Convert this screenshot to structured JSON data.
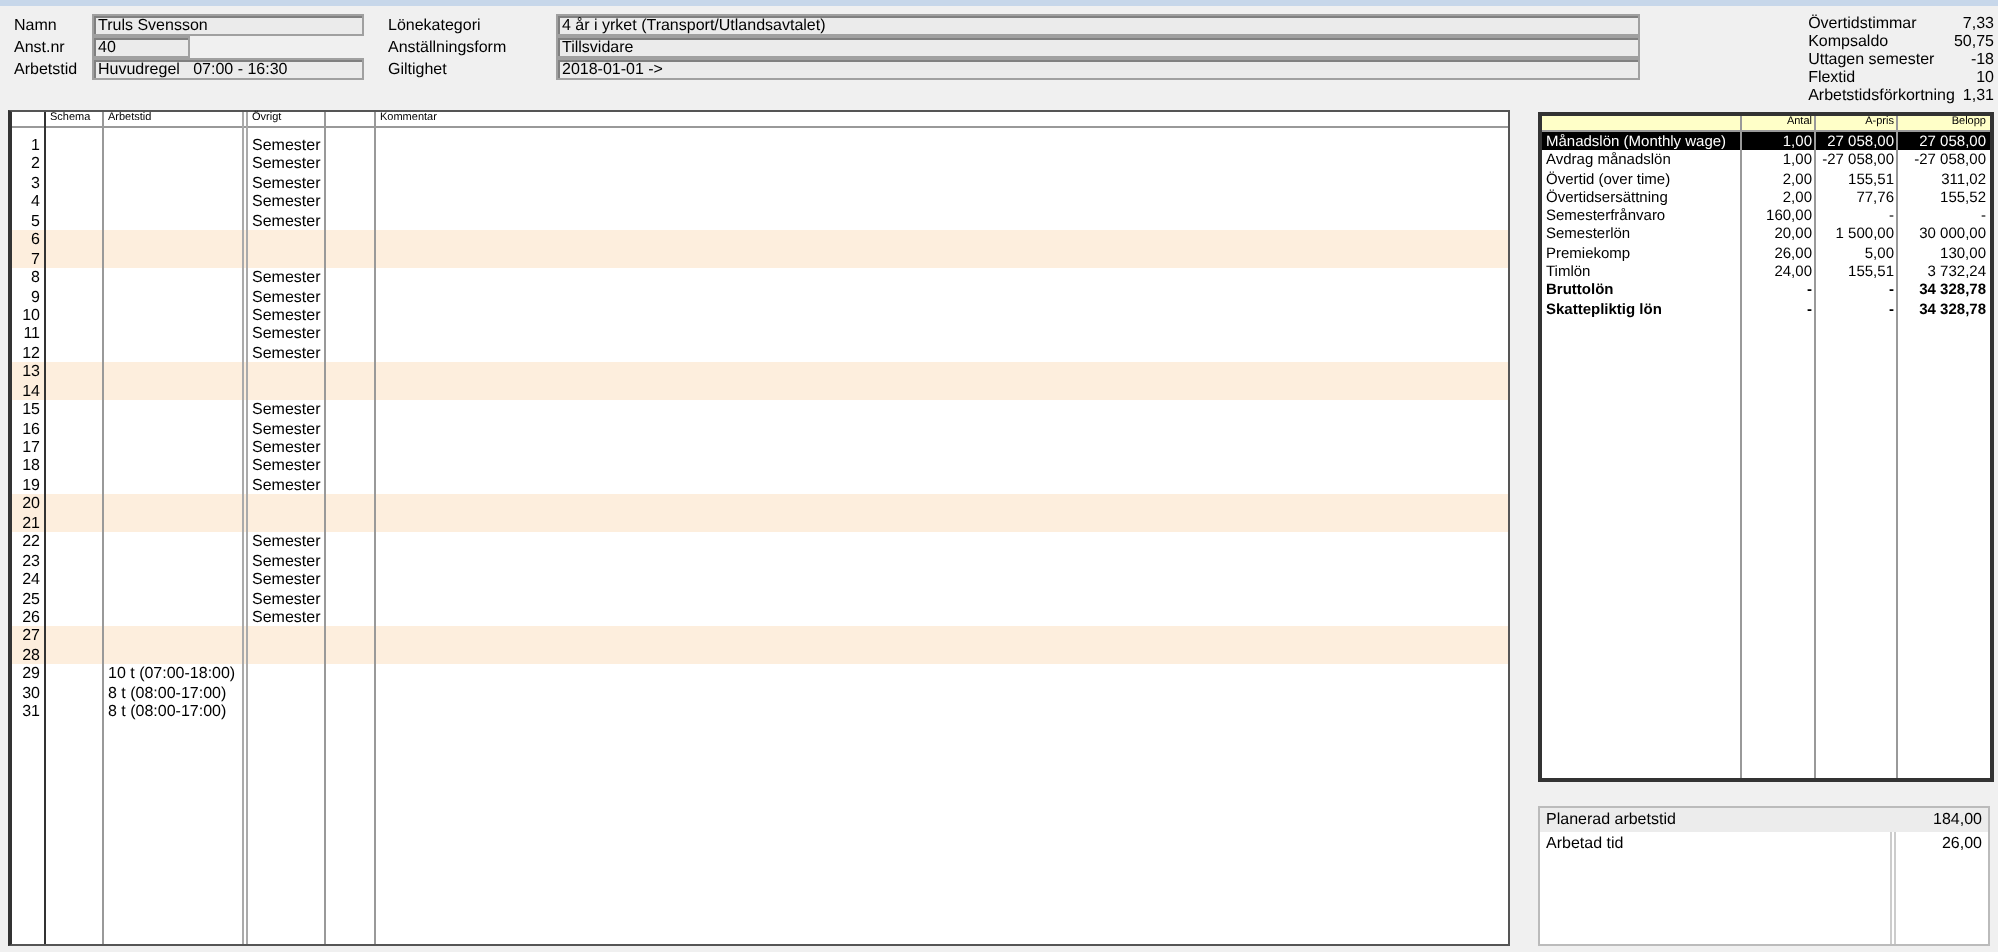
{
  "employee": {
    "fields": [
      {
        "label": "Namn",
        "value": "Truls Svensson"
      },
      {
        "label": "Anst.nr",
        "value": "40"
      },
      {
        "label": "Arbetstid",
        "value": "Huvudregel   07:00 - 16:30"
      }
    ],
    "contract": [
      {
        "label": "Lönekategori",
        "value": "4 år i yrket (Transport/Utlandsavtalet)"
      },
      {
        "label": "Anställningsform",
        "value": "Tillsvidare"
      },
      {
        "label": "Giltighet",
        "value": "2018-01-01 ->"
      }
    ],
    "balances": [
      {
        "label": "Övertidstimmar",
        "value": "7,33"
      },
      {
        "label": "Kompsaldo",
        "value": "50,75"
      },
      {
        "label": "Uttagen semester",
        "value": "-18"
      },
      {
        "label": "Flextid",
        "value": "10"
      },
      {
        "label": "Arbetstidsförkortning",
        "value": "1,31"
      }
    ]
  },
  "schedule": {
    "columns": [
      "Schema",
      "Arbetstid",
      "Övrigt",
      "Kommentar"
    ],
    "rows": [
      {
        "day": "1",
        "ovrigt": "Semester",
        "weekend": false
      },
      {
        "day": "2",
        "ovrigt": "Semester",
        "weekend": false
      },
      {
        "day": "3",
        "ovrigt": "Semester",
        "weekend": false
      },
      {
        "day": "4",
        "ovrigt": "Semester",
        "weekend": false
      },
      {
        "day": "5",
        "ovrigt": "Semester",
        "weekend": false
      },
      {
        "day": "6",
        "weekend": true
      },
      {
        "day": "7",
        "weekend": true
      },
      {
        "day": "8",
        "ovrigt": "Semester",
        "weekend": false
      },
      {
        "day": "9",
        "ovrigt": "Semester",
        "weekend": false
      },
      {
        "day": "10",
        "ovrigt": "Semester",
        "weekend": false
      },
      {
        "day": "11",
        "ovrigt": "Semester",
        "weekend": false
      },
      {
        "day": "12",
        "ovrigt": "Semester",
        "weekend": false
      },
      {
        "day": "13",
        "weekend": true
      },
      {
        "day": "14",
        "weekend": true
      },
      {
        "day": "15",
        "ovrigt": "Semester",
        "weekend": false
      },
      {
        "day": "16",
        "ovrigt": "Semester",
        "weekend": false
      },
      {
        "day": "17",
        "ovrigt": "Semester",
        "weekend": false
      },
      {
        "day": "18",
        "ovrigt": "Semester",
        "weekend": false
      },
      {
        "day": "19",
        "ovrigt": "Semester",
        "weekend": false
      },
      {
        "day": "20",
        "weekend": true
      },
      {
        "day": "21",
        "weekend": true
      },
      {
        "day": "22",
        "ovrigt": "Semester",
        "weekend": false
      },
      {
        "day": "23",
        "ovrigt": "Semester",
        "weekend": false
      },
      {
        "day": "24",
        "ovrigt": "Semester",
        "weekend": false
      },
      {
        "day": "25",
        "ovrigt": "Semester",
        "weekend": false
      },
      {
        "day": "26",
        "ovrigt": "Semester",
        "weekend": false
      },
      {
        "day": "27",
        "weekend": true
      },
      {
        "day": "28",
        "weekend": true
      },
      {
        "day": "29",
        "arbetstid": "10 t (07:00-18:00)",
        "weekend": false
      },
      {
        "day": "30",
        "arbetstid": "8 t (08:00-17:00)",
        "weekend": false
      },
      {
        "day": "31",
        "arbetstid": "8 t (08:00-17:00)",
        "weekend": false
      }
    ]
  },
  "salary": {
    "columns": [
      "Antal",
      "A-pris",
      "Belopp"
    ],
    "rows": [
      {
        "name": "Månadslön (Monthly wage)",
        "antal": "1,00",
        "apris": "27 058,00",
        "belopp": "27 058,00",
        "selected": true,
        "bold": false
      },
      {
        "name": "Avdrag månadslön",
        "antal": "1,00",
        "apris": "-27 058,00",
        "belopp": "-27 058,00",
        "selected": false,
        "bold": false
      },
      {
        "name": "Övertid (over time)",
        "antal": "2,00",
        "apris": "155,51",
        "belopp": "311,02",
        "selected": false,
        "bold": false
      },
      {
        "name": "Övertidsersättning",
        "antal": "2,00",
        "apris": "77,76",
        "belopp": "155,52",
        "selected": false,
        "bold": false
      },
      {
        "name": "Semesterfrånvaro",
        "antal": "160,00",
        "apris": "-",
        "belopp": "-",
        "selected": false,
        "bold": false
      },
      {
        "name": "Semesterlön",
        "antal": "20,00",
        "apris": "1 500,00",
        "belopp": "30 000,00",
        "selected": false,
        "bold": false
      },
      {
        "name": "Premiekomp",
        "antal": "26,00",
        "apris": "5,00",
        "belopp": "130,00",
        "selected": false,
        "bold": false
      },
      {
        "name": "Timlön",
        "antal": "24,00",
        "apris": "155,51",
        "belopp": "3 732,24",
        "selected": false,
        "bold": false
      },
      {
        "name": "Bruttolön",
        "antal": "-",
        "apris": "-",
        "belopp": "34 328,78",
        "selected": false,
        "bold": true
      },
      {
        "name": "Skattepliktig lön",
        "antal": "-",
        "apris": "-",
        "belopp": "34 328,78",
        "selected": false,
        "bold": true
      }
    ]
  },
  "hours": [
    {
      "label": "Planerad arbetstid",
      "value": "184,00"
    },
    {
      "label": "Arbetad tid",
      "value": "26,00"
    }
  ]
}
